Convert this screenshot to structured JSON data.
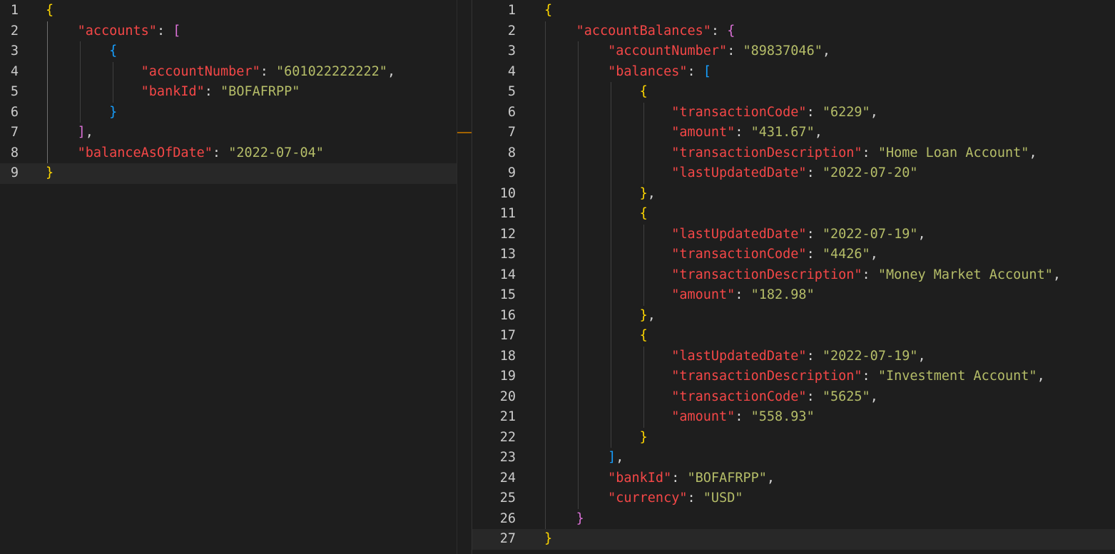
{
  "left_pane": {
    "lines": [
      [
        [
          "{",
          "bk-0"
        ]
      ],
      [
        [
          "    ",
          ""
        ],
        [
          "\"accounts\"",
          "tk-key"
        ],
        [
          ": ",
          "tk-punct"
        ],
        [
          "[",
          "bk-1"
        ]
      ],
      [
        [
          "        ",
          ""
        ],
        [
          "{",
          "bk-2"
        ]
      ],
      [
        [
          "            ",
          ""
        ],
        [
          "\"accountNumber\"",
          "tk-key"
        ],
        [
          ": ",
          "tk-punct"
        ],
        [
          "\"601022222222\"",
          "tk-str"
        ],
        [
          ",",
          "tk-punct"
        ]
      ],
      [
        [
          "            ",
          ""
        ],
        [
          "\"bankId\"",
          "tk-key"
        ],
        [
          ": ",
          "tk-punct"
        ],
        [
          "\"BOFAFRPP\"",
          "tk-str"
        ]
      ],
      [
        [
          "        ",
          ""
        ],
        [
          "}",
          "bk-2"
        ]
      ],
      [
        [
          "    ",
          ""
        ],
        [
          "]",
          "bk-1"
        ],
        [
          ",",
          "tk-punct"
        ]
      ],
      [
        [
          "    ",
          ""
        ],
        [
          "\"balanceAsOfDate\"",
          "tk-key"
        ],
        [
          ": ",
          "tk-punct"
        ],
        [
          "\"2022-07-04\"",
          "tk-str"
        ]
      ],
      [
        [
          "}",
          "bk-0"
        ]
      ]
    ],
    "current_line": 9
  },
  "right_pane": {
    "lines": [
      [
        [
          "{",
          "bk-0"
        ]
      ],
      [
        [
          "    ",
          ""
        ],
        [
          "\"accountBalances\"",
          "tk-key"
        ],
        [
          ": ",
          "tk-punct"
        ],
        [
          "{",
          "bk-1"
        ]
      ],
      [
        [
          "        ",
          ""
        ],
        [
          "\"accountNumber\"",
          "tk-key"
        ],
        [
          ": ",
          "tk-punct"
        ],
        [
          "\"89837046\"",
          "tk-str"
        ],
        [
          ",",
          "tk-punct"
        ]
      ],
      [
        [
          "        ",
          ""
        ],
        [
          "\"balances\"",
          "tk-key"
        ],
        [
          ": ",
          "tk-punct"
        ],
        [
          "[",
          "bk-2"
        ]
      ],
      [
        [
          "            ",
          ""
        ],
        [
          "{",
          "bk-0"
        ]
      ],
      [
        [
          "                ",
          ""
        ],
        [
          "\"transactionCode\"",
          "tk-key"
        ],
        [
          ": ",
          "tk-punct"
        ],
        [
          "\"6229\"",
          "tk-str"
        ],
        [
          ",",
          "tk-punct"
        ]
      ],
      [
        [
          "                ",
          ""
        ],
        [
          "\"amount\"",
          "tk-key"
        ],
        [
          ": ",
          "tk-punct"
        ],
        [
          "\"431.67\"",
          "tk-str"
        ],
        [
          ",",
          "tk-punct"
        ]
      ],
      [
        [
          "                ",
          ""
        ],
        [
          "\"transactionDescription\"",
          "tk-key"
        ],
        [
          ": ",
          "tk-punct"
        ],
        [
          "\"Home Loan Account\"",
          "tk-str"
        ],
        [
          ",",
          "tk-punct"
        ]
      ],
      [
        [
          "                ",
          ""
        ],
        [
          "\"lastUpdatedDate\"",
          "tk-key"
        ],
        [
          ": ",
          "tk-punct"
        ],
        [
          "\"2022-07-20\"",
          "tk-str"
        ]
      ],
      [
        [
          "            ",
          ""
        ],
        [
          "}",
          "bk-0"
        ],
        [
          ",",
          "tk-punct"
        ]
      ],
      [
        [
          "            ",
          ""
        ],
        [
          "{",
          "bk-0"
        ]
      ],
      [
        [
          "                ",
          ""
        ],
        [
          "\"lastUpdatedDate\"",
          "tk-key"
        ],
        [
          ": ",
          "tk-punct"
        ],
        [
          "\"2022-07-19\"",
          "tk-str"
        ],
        [
          ",",
          "tk-punct"
        ]
      ],
      [
        [
          "                ",
          ""
        ],
        [
          "\"transactionCode\"",
          "tk-key"
        ],
        [
          ": ",
          "tk-punct"
        ],
        [
          "\"4426\"",
          "tk-str"
        ],
        [
          ",",
          "tk-punct"
        ]
      ],
      [
        [
          "                ",
          ""
        ],
        [
          "\"transactionDescription\"",
          "tk-key"
        ],
        [
          ": ",
          "tk-punct"
        ],
        [
          "\"Money Market Account\"",
          "tk-str"
        ],
        [
          ",",
          "tk-punct"
        ]
      ],
      [
        [
          "                ",
          ""
        ],
        [
          "\"amount\"",
          "tk-key"
        ],
        [
          ": ",
          "tk-punct"
        ],
        [
          "\"182.98\"",
          "tk-str"
        ]
      ],
      [
        [
          "            ",
          ""
        ],
        [
          "}",
          "bk-0"
        ],
        [
          ",",
          "tk-punct"
        ]
      ],
      [
        [
          "            ",
          ""
        ],
        [
          "{",
          "bk-0"
        ]
      ],
      [
        [
          "                ",
          ""
        ],
        [
          "\"lastUpdatedDate\"",
          "tk-key"
        ],
        [
          ": ",
          "tk-punct"
        ],
        [
          "\"2022-07-19\"",
          "tk-str"
        ],
        [
          ",",
          "tk-punct"
        ]
      ],
      [
        [
          "                ",
          ""
        ],
        [
          "\"transactionDescription\"",
          "tk-key"
        ],
        [
          ": ",
          "tk-punct"
        ],
        [
          "\"Investment Account\"",
          "tk-str"
        ],
        [
          ",",
          "tk-punct"
        ]
      ],
      [
        [
          "                ",
          ""
        ],
        [
          "\"transactionCode\"",
          "tk-key"
        ],
        [
          ": ",
          "tk-punct"
        ],
        [
          "\"5625\"",
          "tk-str"
        ],
        [
          ",",
          "tk-punct"
        ]
      ],
      [
        [
          "                ",
          ""
        ],
        [
          "\"amount\"",
          "tk-key"
        ],
        [
          ": ",
          "tk-punct"
        ],
        [
          "\"558.93\"",
          "tk-str"
        ]
      ],
      [
        [
          "            ",
          ""
        ],
        [
          "}",
          "bk-0"
        ]
      ],
      [
        [
          "        ",
          ""
        ],
        [
          "]",
          "bk-2"
        ],
        [
          ",",
          "tk-punct"
        ]
      ],
      [
        [
          "        ",
          ""
        ],
        [
          "\"bankId\"",
          "tk-key"
        ],
        [
          ": ",
          "tk-punct"
        ],
        [
          "\"BOFAFRPP\"",
          "tk-str"
        ],
        [
          ",",
          "tk-punct"
        ]
      ],
      [
        [
          "        ",
          ""
        ],
        [
          "\"currency\"",
          "tk-key"
        ],
        [
          ": ",
          "tk-punct"
        ],
        [
          "\"USD\"",
          "tk-str"
        ]
      ],
      [
        [
          "    ",
          ""
        ],
        [
          "}",
          "bk-1"
        ]
      ],
      [
        [
          "}",
          "bk-0"
        ]
      ]
    ],
    "current_line": 27
  },
  "colors": {
    "background": "#1e1e1e",
    "line_number": "#cccccc",
    "key": "#f44747",
    "string": "#b5bd68",
    "bracket_level_1": "#ffd700",
    "bracket_level_2": "#da70d6",
    "bracket_level_3": "#179fff",
    "change_marker": "#a16200"
  }
}
